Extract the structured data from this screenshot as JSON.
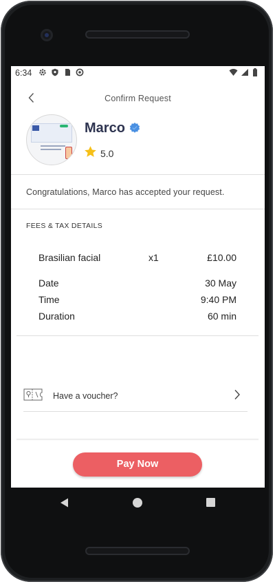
{
  "status_bar": {
    "time": "6:34",
    "icons_left": [
      "gear-icon",
      "shield-icon",
      "sim-icon",
      "no-disturb-icon"
    ],
    "icons_right": [
      "wifi-icon",
      "signal-icon",
      "battery-icon"
    ]
  },
  "header": {
    "title": "Confirm Request",
    "back_icon": "chevron-left-icon"
  },
  "provider": {
    "name": "Marco",
    "verified_icon": "verified-badge-icon",
    "rating": "5.0",
    "rating_icon": "star-icon"
  },
  "message": "Congratulations, Marco has accepted your request.",
  "fees": {
    "section_title": "FEES & TAX DETAILS",
    "service": {
      "label": "Brasilian facial",
      "quantity": "x1",
      "price": "£10.00"
    },
    "details": [
      {
        "label": "Date",
        "value": "30 May"
      },
      {
        "label": "Time",
        "value": "9:40 PM"
      },
      {
        "label": "Duration",
        "value": "60 min"
      }
    ]
  },
  "voucher": {
    "label": "Have a voucher?",
    "icon": "voucher-ticket-icon",
    "chevron": "chevron-right-icon"
  },
  "pay_button": {
    "label": "Pay Now"
  },
  "colors": {
    "accent": "#ec5f63",
    "verified": "#4a90e2",
    "star": "#f6c018",
    "name": "#2e3450"
  }
}
